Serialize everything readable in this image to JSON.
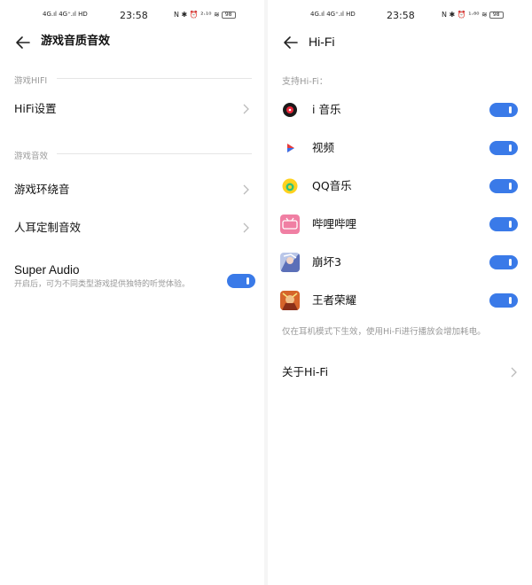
{
  "left": {
    "status": {
      "signal": "4G.ıl 4G⁺.ıl HD",
      "time": "23:58",
      "icons": "N ✱ ⏰ ²·¹⁰ ≋",
      "battery": "98"
    },
    "header": {
      "title": "游戏音质音效"
    },
    "sections": {
      "hifi": "游戏HIFI",
      "audio": "游戏音效"
    },
    "rows": {
      "hifi_settings": "HiFi设置",
      "surround": "游戏环绕音",
      "custom": "人耳定制音效"
    },
    "super_audio": {
      "label": "Super Audio",
      "desc": "开启后，可为不同类型游戏提供独特的听觉体验。",
      "enabled": true
    }
  },
  "right": {
    "status": {
      "signal": "4G.ıl 4G⁺.ıl HD",
      "time": "23:58",
      "icons": "N ✱ ⏰ ¹·⁸⁰ ≋",
      "battery": "98"
    },
    "header": {
      "title": "Hi-Fi"
    },
    "support_label": "支持Hi-Fi：",
    "apps": [
      {
        "name": "i 音乐",
        "icon": "music-app-icon",
        "enabled": true
      },
      {
        "name": "视频",
        "icon": "video-app-icon",
        "enabled": true
      },
      {
        "name": "QQ音乐",
        "icon": "qq-music-icon",
        "enabled": true
      },
      {
        "name": "哔哩哔哩",
        "icon": "bilibili-icon",
        "enabled": true
      },
      {
        "name": "崩坏3",
        "icon": "honkai-icon",
        "enabled": true
      },
      {
        "name": "王者荣耀",
        "icon": "honor-of-kings-icon",
        "enabled": true
      }
    ],
    "note": "仅在耳机模式下生效，使用Hi-Fi进行播放会增加耗电。",
    "about": "关于Hi-Fi"
  },
  "colors": {
    "accent": "#3a7ae8",
    "secondary_text": "#999999"
  }
}
